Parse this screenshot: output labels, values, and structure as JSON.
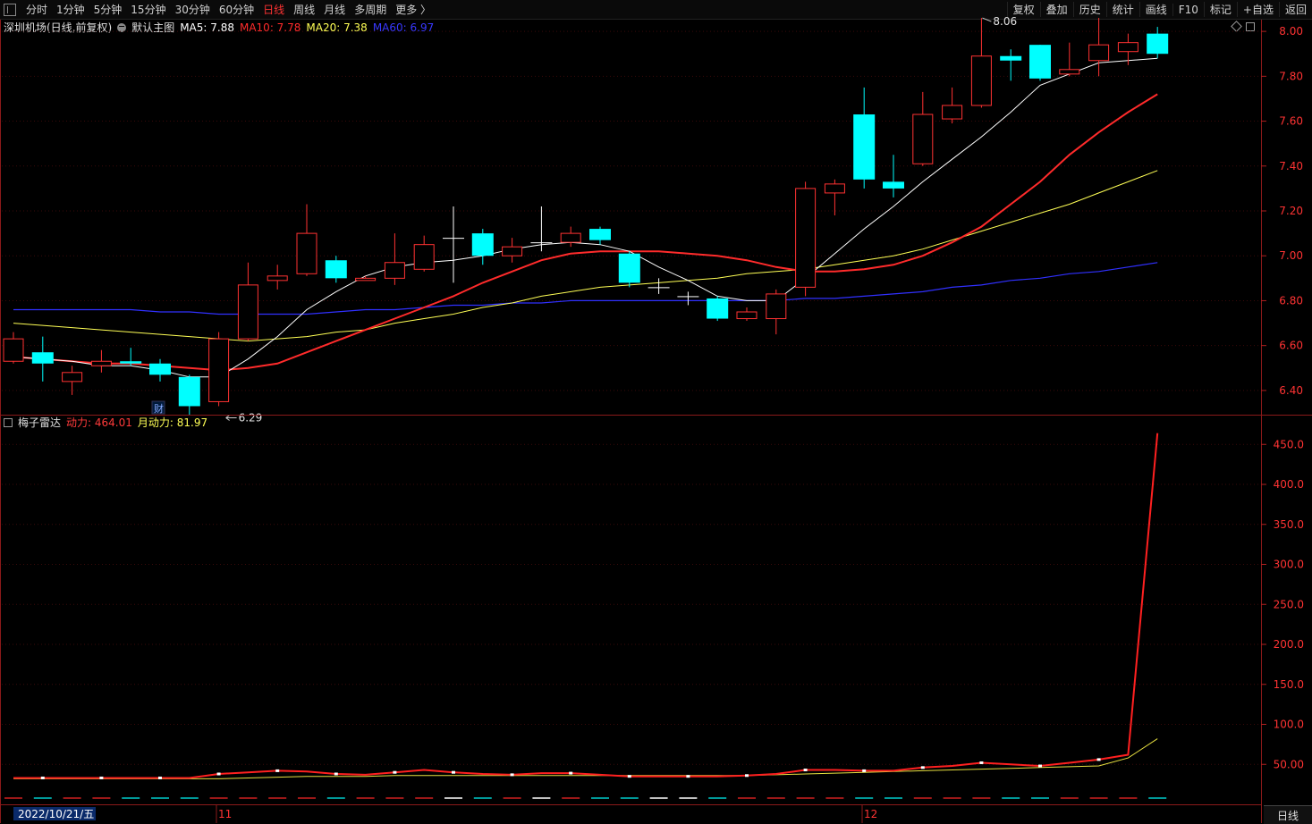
{
  "toolbar": {
    "periods": [
      "分时",
      "1分钟",
      "5分钟",
      "15分钟",
      "30分钟",
      "60分钟",
      "日线",
      "周线",
      "月线",
      "多周期",
      "更多 〉"
    ],
    "active_period": "日线",
    "right_buttons": [
      "复权",
      "叠加",
      "历史",
      "统计",
      "画线",
      "F10",
      "标记",
      "+自选",
      "返回"
    ]
  },
  "main_chart": {
    "stock": "深圳机场(日线,前复权)",
    "template": "默认主图",
    "ma": [
      {
        "label": "MA5: 7.88",
        "color": "#ffffff"
      },
      {
        "label": "MA10: 7.78",
        "color": "#ff2b2b"
      },
      {
        "label": "MA20: 7.38",
        "color": "#ffff55"
      },
      {
        "label": "MA60: 6.97",
        "color": "#3030ff"
      }
    ],
    "high_label": "8.06",
    "low_label": "6.29",
    "event_marker": "财",
    "y_ticks": [
      "8.00",
      "7.80",
      "7.60",
      "7.40",
      "7.20",
      "7.00",
      "6.80",
      "6.60",
      "6.40"
    ]
  },
  "indicator": {
    "name": "梅子雷达",
    "dongli": "动力: 464.01",
    "yuedongli": "月动力: 81.97",
    "y_ticks": [
      "450.0",
      "400.0",
      "350.0",
      "300.0",
      "250.0",
      "200.0",
      "150.0",
      "100.0",
      "50.00"
    ]
  },
  "x_axis": {
    "date_label": "2022/10/21/五",
    "month_labels": [
      "11",
      "12"
    ]
  },
  "bottom_tab": "日线",
  "colors": {
    "up": "#ff3232",
    "down": "#00ffff",
    "ma5": "#ffffff",
    "ma10": "#ff2b2b",
    "ma20": "#ffff55",
    "ma60": "#3030ff"
  },
  "chart_data": {
    "type": "candlestick",
    "ylim": [
      6.3,
      8.1
    ],
    "candles": [
      {
        "o": 6.53,
        "c": 6.63,
        "h": 6.66,
        "l": 6.52
      },
      {
        "o": 6.57,
        "c": 6.52,
        "h": 6.64,
        "l": 6.44
      },
      {
        "o": 6.44,
        "c": 6.48,
        "h": 6.51,
        "l": 6.38
      },
      {
        "o": 6.51,
        "c": 6.53,
        "h": 6.58,
        "l": 6.48
      },
      {
        "o": 6.53,
        "c": 6.52,
        "h": 6.59,
        "l": 6.51
      },
      {
        "o": 6.52,
        "c": 6.47,
        "h": 6.54,
        "l": 6.44
      },
      {
        "o": 6.46,
        "c": 6.33,
        "h": 6.47,
        "l": 6.29
      },
      {
        "o": 6.35,
        "c": 6.63,
        "h": 6.66,
        "l": 6.33
      },
      {
        "o": 6.63,
        "c": 6.87,
        "h": 6.97,
        "l": 6.62
      },
      {
        "o": 6.89,
        "c": 6.91,
        "h": 6.96,
        "l": 6.85
      },
      {
        "o": 6.92,
        "c": 7.1,
        "h": 7.23,
        "l": 6.91
      },
      {
        "o": 6.98,
        "c": 6.9,
        "h": 7.0,
        "l": 6.88
      },
      {
        "o": 6.89,
        "c": 6.9,
        "h": 6.91,
        "l": 6.89
      },
      {
        "o": 6.9,
        "c": 6.97,
        "h": 7.1,
        "l": 6.87
      },
      {
        "o": 6.94,
        "c": 7.05,
        "h": 7.09,
        "l": 6.93
      },
      {
        "o": 7.08,
        "c": 7.08,
        "h": 7.22,
        "l": 6.88
      },
      {
        "o": 7.1,
        "c": 7.0,
        "h": 7.12,
        "l": 6.96
      },
      {
        "o": 7.0,
        "c": 7.04,
        "h": 7.08,
        "l": 6.97
      },
      {
        "o": 7.06,
        "c": 7.06,
        "h": 7.22,
        "l": 7.02
      },
      {
        "o": 7.06,
        "c": 7.1,
        "h": 7.13,
        "l": 7.04
      },
      {
        "o": 7.12,
        "c": 7.07,
        "h": 7.13,
        "l": 7.05
      },
      {
        "o": 7.01,
        "c": 6.88,
        "h": 7.02,
        "l": 6.86
      },
      {
        "o": 6.86,
        "c": 6.86,
        "h": 6.9,
        "l": 6.83
      },
      {
        "o": 6.82,
        "c": 6.82,
        "h": 6.84,
        "l": 6.78
      },
      {
        "o": 6.81,
        "c": 6.72,
        "h": 6.82,
        "l": 6.71
      },
      {
        "o": 6.72,
        "c": 6.75,
        "h": 6.77,
        "l": 6.71
      },
      {
        "o": 6.72,
        "c": 6.83,
        "h": 6.85,
        "l": 6.65
      },
      {
        "o": 6.86,
        "c": 7.3,
        "h": 7.33,
        "l": 6.82
      },
      {
        "o": 7.28,
        "c": 7.32,
        "h": 7.34,
        "l": 7.18
      },
      {
        "o": 7.63,
        "c": 7.34,
        "h": 7.75,
        "l": 7.3
      },
      {
        "o": 7.33,
        "c": 7.3,
        "h": 7.45,
        "l": 7.26
      },
      {
        "o": 7.41,
        "c": 7.63,
        "h": 7.73,
        "l": 7.4
      },
      {
        "o": 7.61,
        "c": 7.67,
        "h": 7.75,
        "l": 7.59
      },
      {
        "o": 7.67,
        "c": 7.89,
        "h": 8.06,
        "l": 7.66
      },
      {
        "o": 7.89,
        "c": 7.87,
        "h": 7.92,
        "l": 7.78
      },
      {
        "o": 7.94,
        "c": 7.79,
        "h": 7.94,
        "l": 7.78
      },
      {
        "o": 7.81,
        "c": 7.83,
        "h": 7.95,
        "l": 7.8
      },
      {
        "o": 7.87,
        "c": 7.94,
        "h": 8.06,
        "l": 7.8
      },
      {
        "o": 7.91,
        "c": 7.95,
        "h": 7.99,
        "l": 7.85
      },
      {
        "o": 7.99,
        "c": 7.9,
        "h": 8.02,
        "l": 7.88
      }
    ],
    "ma5": [
      6.55,
      6.54,
      6.53,
      6.51,
      6.51,
      6.49,
      6.46,
      6.46,
      6.54,
      6.64,
      6.76,
      6.84,
      6.91,
      6.95,
      6.97,
      6.98,
      7.0,
      7.03,
      7.05,
      7.06,
      7.05,
      7.02,
      6.95,
      6.89,
      6.82,
      6.8,
      6.8,
      6.9,
      7.01,
      7.12,
      7.22,
      7.33,
      7.43,
      7.53,
      7.64,
      7.76,
      7.81,
      7.86,
      7.87,
      7.88
    ],
    "ma10": [
      6.55,
      6.54,
      6.53,
      6.52,
      6.52,
      6.51,
      6.5,
      6.49,
      6.5,
      6.52,
      6.57,
      6.62,
      6.67,
      6.72,
      6.77,
      6.82,
      6.88,
      6.93,
      6.98,
      7.01,
      7.02,
      7.02,
      7.02,
      7.01,
      7.0,
      6.98,
      6.95,
      6.93,
      6.93,
      6.94,
      6.96,
      7.0,
      7.06,
      7.13,
      7.23,
      7.33,
      7.45,
      7.55,
      7.64,
      7.72
    ],
    "ma20": [
      6.7,
      6.69,
      6.68,
      6.67,
      6.66,
      6.65,
      6.64,
      6.63,
      6.62,
      6.63,
      6.64,
      6.66,
      6.67,
      6.7,
      6.72,
      6.74,
      6.77,
      6.79,
      6.82,
      6.84,
      6.86,
      6.87,
      6.88,
      6.89,
      6.9,
      6.92,
      6.93,
      6.94,
      6.96,
      6.98,
      7.0,
      7.03,
      7.07,
      7.11,
      7.15,
      7.19,
      7.23,
      7.28,
      7.33,
      7.38
    ],
    "ma60": [
      6.76,
      6.76,
      6.76,
      6.76,
      6.76,
      6.75,
      6.75,
      6.74,
      6.74,
      6.74,
      6.74,
      6.75,
      6.76,
      6.76,
      6.77,
      6.78,
      6.78,
      6.79,
      6.79,
      6.8,
      6.8,
      6.8,
      6.8,
      6.8,
      6.8,
      6.8,
      6.8,
      6.81,
      6.81,
      6.82,
      6.83,
      6.84,
      6.86,
      6.87,
      6.89,
      6.9,
      6.92,
      6.93,
      6.95,
      6.97
    ],
    "indicator": {
      "ylim": [
        0,
        480
      ],
      "dongli": [
        33,
        33,
        33,
        33,
        33,
        33,
        33,
        38,
        40,
        42,
        41,
        38,
        37,
        40,
        43,
        40,
        38,
        37,
        39,
        39,
        37,
        35,
        35,
        35,
        35,
        36,
        38,
        43,
        43,
        42,
        42,
        46,
        48,
        52,
        50,
        48,
        52,
        56,
        62,
        464.01
      ],
      "yuedongli": [
        32,
        32,
        32,
        32,
        32,
        32,
        32,
        32,
        33,
        34,
        35,
        35,
        35,
        36,
        36,
        36,
        36,
        36,
        36,
        36,
        36,
        36,
        36,
        36,
        36,
        36,
        37,
        38,
        39,
        40,
        41,
        42,
        43,
        44,
        45,
        46,
        47,
        48,
        58,
        81.97
      ]
    }
  }
}
